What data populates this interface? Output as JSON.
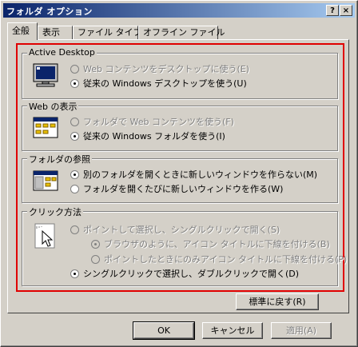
{
  "window": {
    "title": "フォルダ オプション",
    "help_btn": "?",
    "close_btn": "×"
  },
  "tabs": [
    {
      "label": "全般"
    },
    {
      "label": "表示"
    },
    {
      "label": "ファイル タイプ"
    },
    {
      "label": "オフライン ファイル"
    }
  ],
  "groups": {
    "active_desktop": {
      "title": "Active Desktop",
      "opt1": "Web コンテンツをデスクトップに使う(E)",
      "opt2": "従来の Windows デスクトップを使う(U)"
    },
    "web_view": {
      "title": "Web の表示",
      "opt1": "フォルダで Web コンテンツを使う(F)",
      "opt2": "従来の Windows フォルダを使う(I)"
    },
    "browse": {
      "title": "フォルダの参照",
      "opt1": "別のフォルダを開くときに新しいウィンドウを作らない(M)",
      "opt2": "フォルダを開くたびに新しいウィンドウを作る(W)"
    },
    "click": {
      "title": "クリック方法",
      "opt1": "ポイントして選択し、シングルクリックで開く(S)",
      "opt1a": "ブラウザのように、アイコン タイトルに下線を付ける(B)",
      "opt1b": "ポイントしたときにのみアイコン タイトルに下線を付ける(P)",
      "opt2": "シングルクリックで選択し、ダブルクリックで開く(D)"
    }
  },
  "buttons": {
    "restore": "標準に戻す(R)",
    "ok": "OK",
    "cancel": "キャンセル",
    "apply": "適用(A)"
  },
  "colors": {
    "highlight": "#e00000",
    "face": "#d4d0c8",
    "title_start": "#0a246a",
    "title_end": "#a6caf0"
  }
}
